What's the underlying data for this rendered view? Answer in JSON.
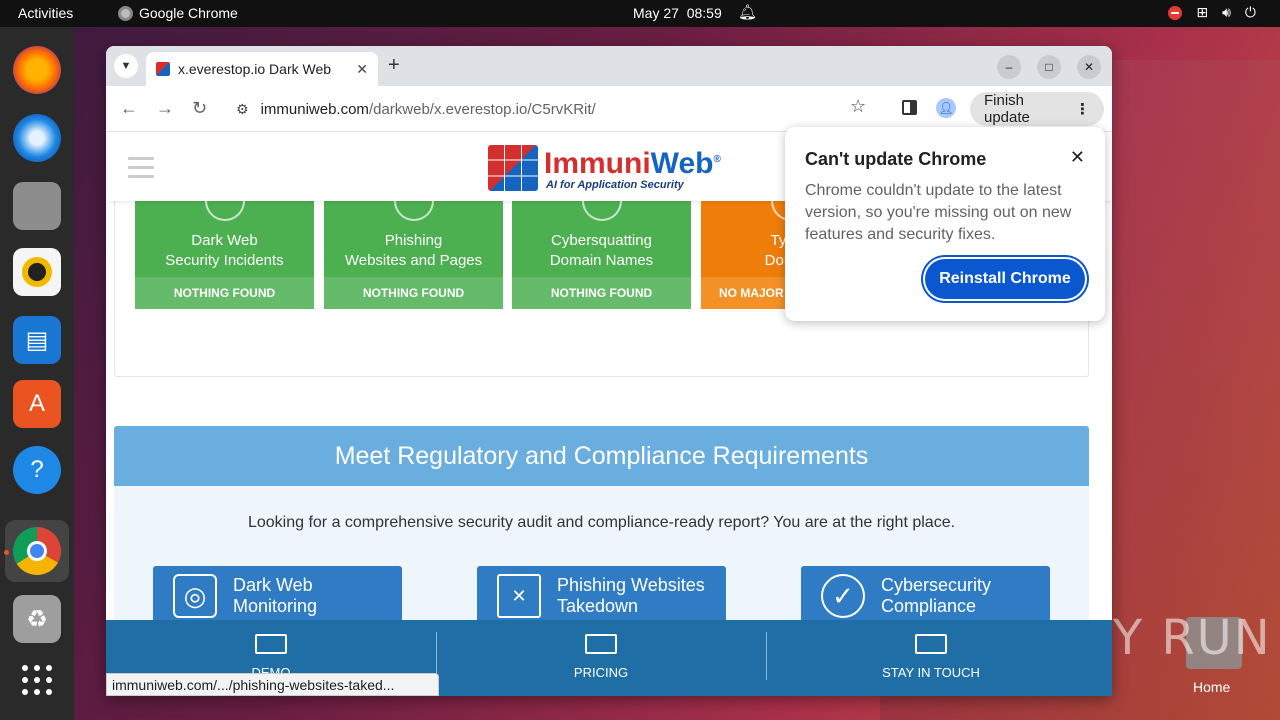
{
  "topbar": {
    "activities": "Activities",
    "app_name": "Google Chrome",
    "date": "May 27",
    "time": "08:59"
  },
  "dock": {
    "items": [
      "firefox-icon",
      "thunderbird-icon",
      "files-icon",
      "rhythmbox-icon",
      "writer-icon",
      "app-center-icon",
      "help-icon",
      "chrome-icon",
      "trash-icon",
      "show-apps-icon"
    ]
  },
  "desktop": {
    "home_label": "Home",
    "watermark": "ANY RUN"
  },
  "browser": {
    "tab_title": "x.everestop.io Dark Web",
    "url_host": "immuniweb.com",
    "url_path": "/darkweb/x.everestop.io/C5rvKRit/",
    "finish_update": "Finish update",
    "status_url": "immuniweb.com/.../phishing-websites-taked..."
  },
  "site": {
    "logo_immuni": "Immuni",
    "logo_web": "Web",
    "logo_reg": "®",
    "logo_tag": "AI for Application Security",
    "cards": [
      {
        "title_1": "Dark Web",
        "title_2": "Security Incidents",
        "status": "NOTHING FOUND",
        "color": "#4caf50"
      },
      {
        "title_1": "Phishing",
        "title_2": "Websites and Pages",
        "status": "NOTHING FOUND",
        "color": "#4caf50"
      },
      {
        "title_1": "Cybersquatting",
        "title_2": "Domain Names",
        "status": "NOTHING FOUND",
        "color": "#4caf50"
      },
      {
        "title_1": "Typos",
        "title_2": "Domain",
        "status": "NO MAJOR",
        "color": "#ef7d0a"
      }
    ],
    "compliance_title": "Meet Regulatory and Compliance Requirements",
    "compliance_text": "Looking for a comprehensive security audit and compliance-ready report? You are at the right place.",
    "services": [
      {
        "line1": "Dark Web",
        "line2": "Monitoring",
        "icon": "camera-icon"
      },
      {
        "line1": "Phishing Websites",
        "line2": "Takedown",
        "icon": "document-icon"
      },
      {
        "line1": "Cybersecurity",
        "line2": "Compliance",
        "icon": "checkmark-icon"
      }
    ],
    "bottom_bar": [
      "DEMO",
      "PRICING",
      "STAY IN TOUCH"
    ]
  },
  "popup": {
    "title": "Can't update Chrome",
    "body": "Chrome couldn't update to the latest version, so you're missing out on new features and security fixes.",
    "button": "Reinstall Chrome"
  },
  "colors": {
    "accent": "#0b57d0",
    "success": "#4caf50",
    "warning": "#ef7d0a",
    "site_blue": "#2f7cc4"
  }
}
